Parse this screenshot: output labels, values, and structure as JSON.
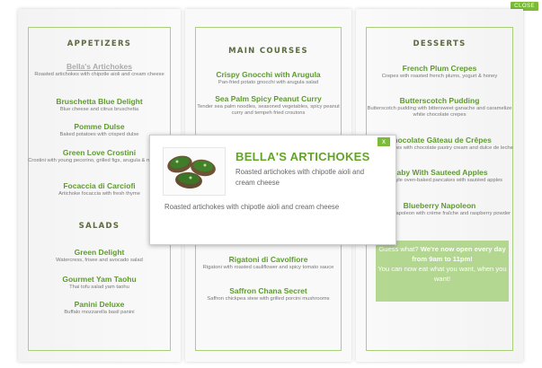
{
  "close_label": "CLOSE",
  "modal": {
    "title": "BELLA'S ARTICHOKES",
    "subtitle": "Roasted artichokes with chipotle aioli and cream cheese",
    "description": "Roasted artichokes with chipotle aioli and cream cheese",
    "close_symbol": "x"
  },
  "left": {
    "appetizers_title": "APPETIZERS",
    "appetizers": [
      {
        "name": "Bella's Artichokes",
        "desc": "Roasted artichokes with chipotle aioli and cream cheese"
      },
      {
        "name": "Bruschetta Blue Delight",
        "desc": "Blue cheese and citrus bruschetta"
      },
      {
        "name": "Pomme Dulse",
        "desc": "Baked potatoes with crisped dulse"
      },
      {
        "name": "Green Love Crostini",
        "desc": "Crostini with young pecorino, grilled figs, arugula & mint pesto"
      },
      {
        "name": "Focaccia di Carciofi",
        "desc": "Artichoke focaccia with fresh thyme"
      }
    ],
    "salads_title": "SALADS",
    "salads": [
      {
        "name": "Green Delight",
        "desc": "Watercress, frisee and avocado salad"
      },
      {
        "name": "Gourmet Yam Taohu",
        "desc": "Thai tofu salad yam taohu"
      },
      {
        "name": "Panini Deluxe",
        "desc": "Buffalo mozzarella basil panini"
      }
    ]
  },
  "middle": {
    "title": "MAIN COURSES",
    "items": [
      {
        "name": "Crispy Gnocchi with Arugula",
        "desc": "Pan-fried potato gnocchi with arugula salad"
      },
      {
        "name": "Sea Palm Spicy Peanut Curry",
        "desc": "Tender sea palm noodles, seasoned vegetables, spicy peanut curry and tempeh fried croutons"
      },
      {
        "name": "Rigatoni di Cavolfiore",
        "desc": "Rigatoni with roasted cauliflower and spicy tomato sauce"
      },
      {
        "name": "Saffron Chana Secret",
        "desc": "Saffron chickpea stew with grilled porcini mushrooms"
      }
    ]
  },
  "right": {
    "title": "DESSERTS",
    "items": [
      {
        "name": "French Plum Crepes",
        "desc": "Crepes with roasted french plums, yogurt & honey"
      },
      {
        "name": "Butterscotch Pudding",
        "desc": "Butterscotch pudding with bittersweet ganache and caramelize white chocolate crepes"
      },
      {
        "name": "Chocolate Gâteau de Crêpes",
        "desc": "Layered crêpes with chocolate pastry cream and dulce de leche"
      },
      {
        "name": "Baby With Sauteed Apples",
        "desc": "Dutch-style oven-baked pancakes with sautéed apples"
      },
      {
        "name": "Blueberry Napoleon",
        "desc": "Blueberry Napoleon with crème fraîche and raspberry powder"
      }
    ],
    "promo_lead": "Guess what? ",
    "promo_bold": "We're now open every day from 9am to 11pm!",
    "promo_tail": "You can now eat what you want, when you want!"
  }
}
